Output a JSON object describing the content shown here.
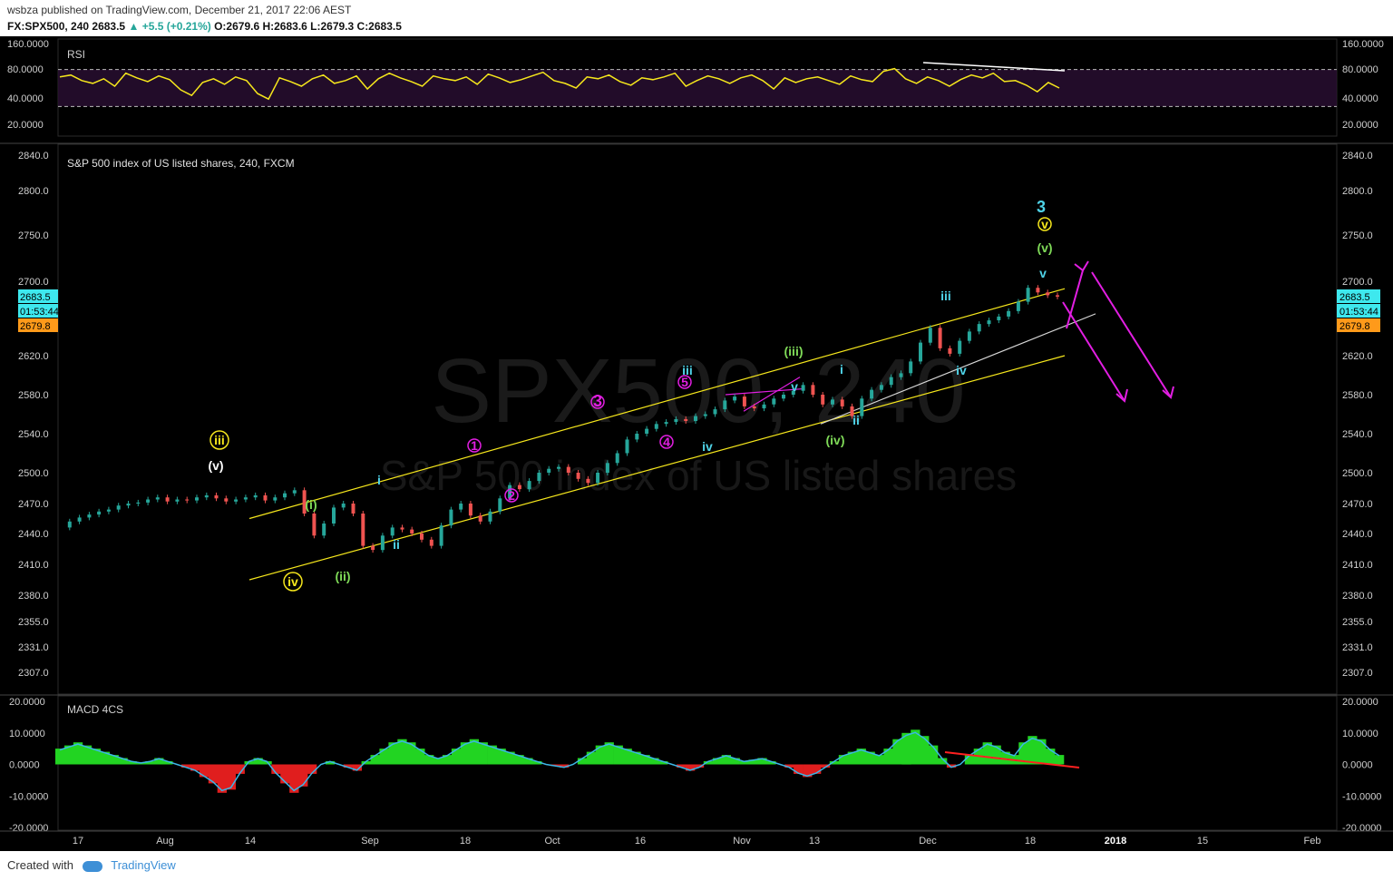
{
  "header": {
    "author": "wsbza",
    "published_text": "published on TradingView.com, December 21, 2017 22:06 AEST",
    "symbol": "FX:SPX500, 240",
    "last": "2683.5",
    "change": "+5.5 (+0.21%)",
    "ohlc": "O:2679.6 H:2683.6 L:2679.3 C:2683.5"
  },
  "footer": {
    "created_with": "Created with",
    "brand": "TradingView"
  },
  "watermark": {
    "line1": "SPX500, 240",
    "line2": "S&P 500 index of US listed shares"
  },
  "colors": {
    "background": "#000000",
    "candle_up": "#26a69a",
    "candle_down": "#ef5350",
    "rsi_line": "#f6e71c",
    "channel": "#f6e71c",
    "projection": "#e21ee2",
    "divergence_rsi": "#ffffff",
    "divergence_macd": "#ff2020",
    "wave_cyan": "#4fd3e8",
    "wave_green": "#7ed957",
    "wave_yellow": "#f6e71c",
    "wave_magenta": "#e21ee2"
  },
  "chart_data": [
    {
      "type": "line",
      "title": "RSI",
      "yticks": [
        "160.0000",
        "80.0000",
        "40.0000",
        "20.0000"
      ],
      "ylim": [
        0,
        100
      ],
      "overbought": 70,
      "oversold": 30,
      "series": [
        {
          "name": "RSI",
          "values": [
            62,
            64,
            58,
            55,
            60,
            52,
            66,
            61,
            57,
            63,
            59,
            48,
            42,
            56,
            60,
            54,
            62,
            58,
            44,
            38,
            61,
            57,
            52,
            60,
            64,
            55,
            58,
            63,
            49,
            60,
            66,
            61,
            57,
            52,
            63,
            60,
            58,
            62,
            54,
            65,
            61,
            56,
            59,
            63,
            67,
            58,
            55,
            50,
            62,
            60,
            64,
            57,
            53,
            61,
            59,
            62,
            66,
            52,
            58,
            63,
            60,
            55,
            61,
            64,
            58,
            49,
            61,
            56,
            60,
            62,
            58,
            54,
            63,
            59,
            57,
            68,
            71,
            60,
            55,
            62,
            58,
            52,
            59,
            64,
            61,
            66,
            57,
            58,
            53,
            46,
            56,
            50
          ]
        }
      ]
    },
    {
      "type": "line",
      "title": "S&P 500 index of US listed shares, 240, FXCM",
      "yticks": [
        "2840.0",
        "2800.0",
        "2750.0",
        "2700.0",
        "2620.0",
        "2580.0",
        "2540.0",
        "2500.0",
        "2470.0",
        "2440.0",
        "2410.0",
        "2380.0",
        "2355.0",
        "2331.0",
        "2307.0"
      ],
      "xticks": [
        "17",
        "Aug",
        "14",
        "Sep",
        "18",
        "Oct",
        "16",
        "Nov",
        "13",
        "Dec",
        "18",
        "2018",
        "15",
        "Feb"
      ],
      "price_labels": {
        "last": "2683.5",
        "countdown": "01:53:44",
        "open": "2679.8"
      },
      "series": [
        {
          "name": "SPX500",
          "values": [
            2446,
            2452,
            2456,
            2459,
            2462,
            2464,
            2468,
            2470,
            2471,
            2474,
            2476,
            2472,
            2474,
            2473,
            2476,
            2478,
            2475,
            2472,
            2474,
            2476,
            2478,
            2473,
            2476,
            2480,
            2483,
            2460,
            2438,
            2450,
            2466,
            2470,
            2460,
            2428,
            2424,
            2438,
            2446,
            2444,
            2440,
            2434,
            2428,
            2448,
            2464,
            2470,
            2458,
            2452,
            2462,
            2475,
            2488,
            2484,
            2492,
            2500,
            2504,
            2506,
            2500,
            2494,
            2490,
            2500,
            2510,
            2520,
            2534,
            2540,
            2545,
            2550,
            2552,
            2555,
            2553,
            2558,
            2560,
            2565,
            2574,
            2578,
            2568,
            2566,
            2570,
            2576,
            2580,
            2584,
            2590,
            2580,
            2570,
            2575,
            2568,
            2558,
            2576,
            2585,
            2590,
            2598,
            2602,
            2614,
            2634,
            2650,
            2628,
            2622,
            2636,
            2646,
            2654,
            2658,
            2662,
            2668,
            2678,
            2693,
            2688,
            2685,
            2683.5
          ]
        }
      ],
      "annotations": [
        "(v)",
        "iii",
        "iv",
        "(i)",
        "(ii)",
        "i",
        "ii",
        "1",
        "2",
        "3",
        "4",
        "5",
        "iii",
        "iv",
        "v",
        "(iii)",
        "i",
        "ii",
        "(iv)",
        "iii",
        "iv",
        "v",
        "(v)",
        "v",
        "3"
      ]
    },
    {
      "type": "bar",
      "title": "MACD 4CS",
      "yticks": [
        "20.0000",
        "10.0000",
        "0.0000",
        "-10.0000",
        "-20.0000"
      ],
      "ylim": [
        -20,
        20
      ],
      "series": [
        {
          "name": "MACD",
          "values": [
            5,
            6,
            7,
            6,
            5,
            4,
            3,
            2,
            1,
            0.5,
            1,
            2,
            1,
            0,
            -1,
            -2,
            -4,
            -6,
            -9,
            -8,
            -3,
            1,
            2,
            1,
            -3,
            -6,
            -9,
            -7,
            -3,
            0,
            1,
            0,
            -1,
            -2,
            1,
            3,
            5,
            7,
            8,
            7,
            5,
            3,
            2,
            3,
            5,
            7,
            8,
            7,
            6,
            5,
            4,
            3,
            2,
            1,
            0,
            -0.5,
            -1,
            0,
            2,
            4,
            6,
            7,
            6,
            5,
            4,
            3,
            2,
            1,
            0,
            -1,
            -2,
            -1,
            1,
            2,
            3,
            2,
            1,
            1.5,
            2,
            1,
            0,
            -1,
            -3,
            -4,
            -3,
            -1,
            1,
            3,
            4,
            5,
            4,
            3,
            5,
            8,
            10,
            11,
            9,
            6,
            2,
            -1,
            0,
            3,
            5,
            7,
            6,
            4,
            3,
            7,
            9,
            8,
            5,
            3
          ]
        }
      ]
    }
  ]
}
